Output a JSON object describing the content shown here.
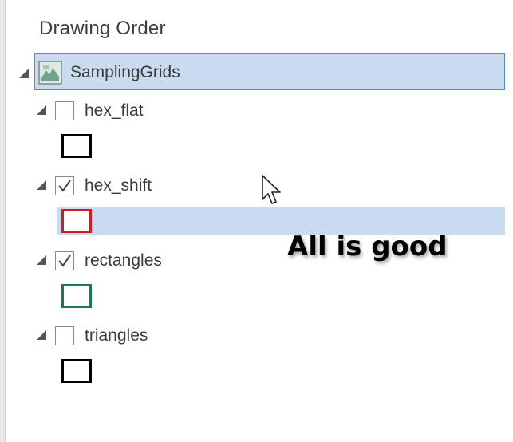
{
  "pane": {
    "title": "Drawing Order"
  },
  "group_layer": {
    "name": "SamplingGrids",
    "expanded": true,
    "selected": true,
    "icon": "group-layer-icon"
  },
  "layers": [
    {
      "name": "hex_flat",
      "checked": false,
      "symbol_color": "#000000"
    },
    {
      "name": "hex_shift",
      "checked": true,
      "symbol_color": "#d7191c"
    },
    {
      "name": "rectangles",
      "checked": true,
      "symbol_color": "#1a7a4c"
    },
    {
      "name": "triangles",
      "checked": false,
      "symbol_color": "#000000"
    }
  ],
  "annotation": {
    "text": "All is good"
  },
  "colors": {
    "selection_fill": "#c9dcef",
    "selection_border": "#4a90d9"
  }
}
